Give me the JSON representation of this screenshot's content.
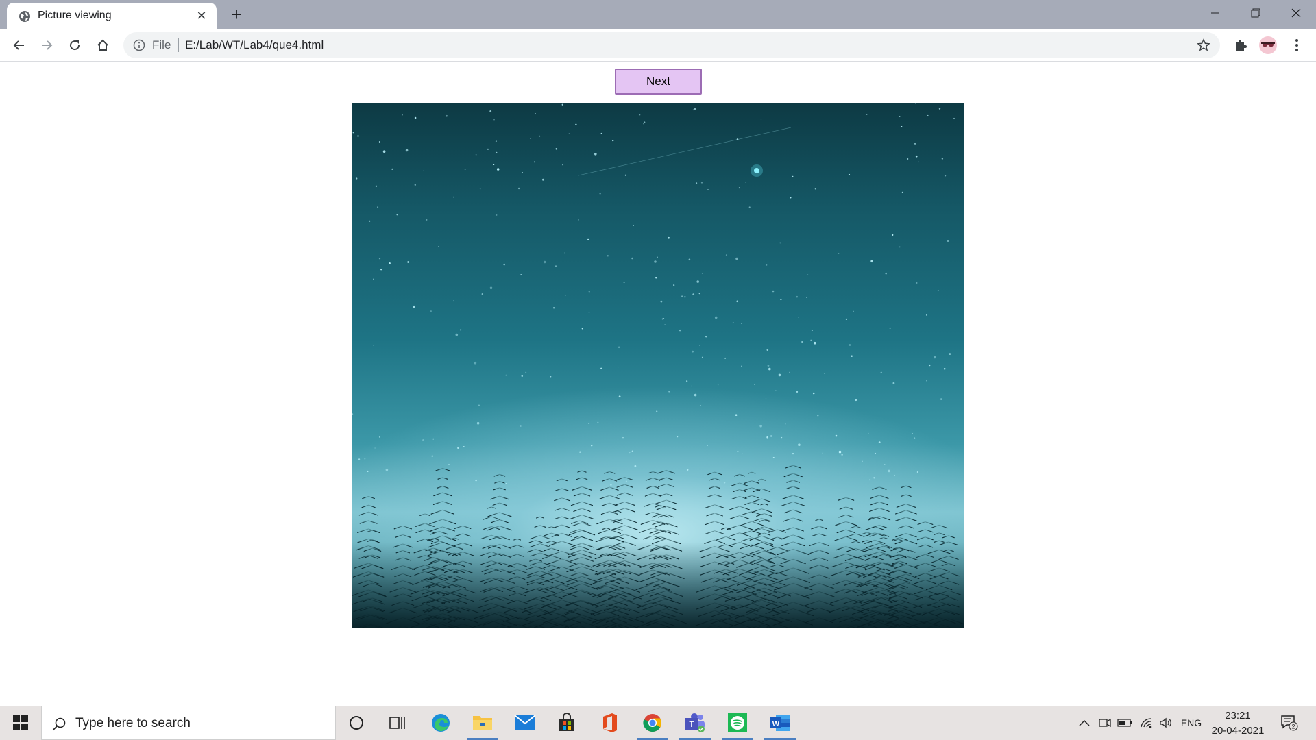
{
  "browser": {
    "tab_title": "Picture viewing",
    "new_tab_label": "+",
    "address_scheme": "File",
    "address_url": "E:/Lab/WT/Lab4/que4.html"
  },
  "page": {
    "next_button_label": "Next"
  },
  "taskbar": {
    "search_placeholder": "Type here to search",
    "language": "ENG",
    "time": "23:21",
    "date": "20-04-2021",
    "notification_count": "2",
    "pinned_apps": [
      "cortana",
      "task-view",
      "edge",
      "file-explorer",
      "mail",
      "store",
      "office",
      "chrome",
      "teams",
      "spotify",
      "word"
    ]
  },
  "colors": {
    "next_button_bg": "#e4c5f3",
    "next_button_border": "#9c6cb4",
    "tabstrip": "#a6abb8",
    "taskbar": "#e7e3e2",
    "taskbar_active": "#4b7fc1"
  }
}
